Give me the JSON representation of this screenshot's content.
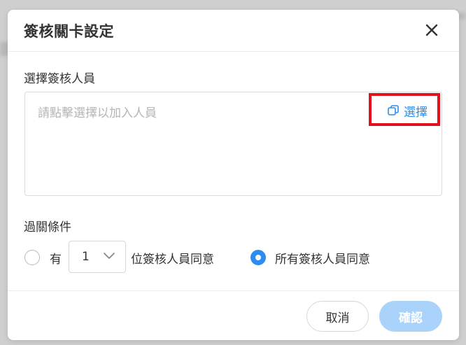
{
  "dialog": {
    "title": "簽核關卡設定",
    "close_icon": "close-icon"
  },
  "approvers": {
    "label": "選擇簽核人員",
    "placeholder": "請點擊選擇以加入人員",
    "select_label": "選擇",
    "select_icon": "copy-icon"
  },
  "condition": {
    "label": "過關條件",
    "option_some": {
      "prefix": "有",
      "count": "1",
      "suffix": "位簽核人員同意",
      "checked": false
    },
    "option_all": {
      "label": "所有簽核人員同意",
      "checked": true
    }
  },
  "footer": {
    "cancel_label": "取消",
    "confirm_label": "確認"
  },
  "colors": {
    "accent": "#2d8cf0",
    "confirm_disabled": "#a9d3fb",
    "highlight": "#e0121b"
  }
}
